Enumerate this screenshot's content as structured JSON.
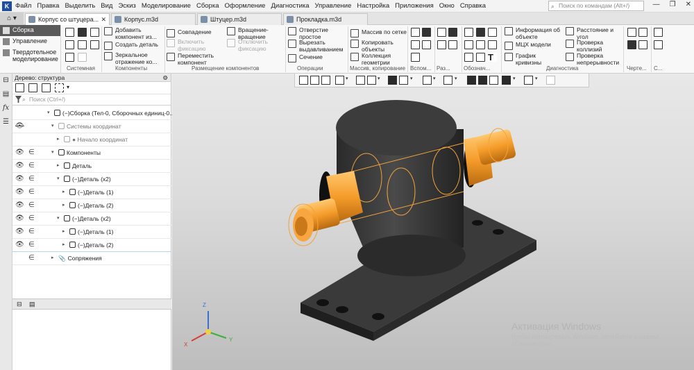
{
  "menu": [
    "Файл",
    "Правка",
    "Выделить",
    "Вид",
    "Эскиз",
    "Моделирование",
    "Сборка",
    "Оформление",
    "Диагностика",
    "Управление",
    "Настройка",
    "Приложения",
    "Окно",
    "Справка"
  ],
  "command_search": {
    "placeholder": "Поиск по командам (Alt+/)"
  },
  "tabs": [
    {
      "label": "Корпус со штуцера..."
    },
    {
      "label": "Корпус.m3d"
    },
    {
      "label": "Штуцер.m3d"
    },
    {
      "label": "Прокладка.m3d"
    }
  ],
  "modes": [
    "Сборка",
    "Управление",
    "Твердотельное моделирование"
  ],
  "ribbon": {
    "system_group": "Системная",
    "components": {
      "add": "Добавить компонент из...",
      "create": "Создать деталь",
      "mirror": "Зеркальное отражение ко...",
      "group": "Компоненты"
    },
    "placement": {
      "coincide": "Совпадение",
      "enable_fix": "Включить фиксацию",
      "move": "Переместить компонент",
      "rotate": "Вращение-вращение",
      "disable_fix": "Отключить фиксацию",
      "group": "Размещение компонентов"
    },
    "operations": {
      "hole": "Отверстие простое",
      "cut": "Вырезать выдавливанием",
      "section": "Сечение",
      "group": "Операции"
    },
    "array": {
      "grid": "Массив по сетке",
      "copy": "Копировать объекты",
      "collection": "Коллекция геометрии",
      "group": "Массив, копирование"
    },
    "aux_group": "Вспом...",
    "size_group": "Раз...",
    "desig_group": "Обознач...",
    "diag": {
      "info": "Информация об объекте",
      "mcx": "МЦХ модели",
      "curv": "График кривизны",
      "dist": "Расстояние и угол",
      "collision": "Проверка коллизий",
      "continuity": "Проверка непрерывности",
      "group": "Диагностика"
    },
    "drawing_group": "Черте...",
    "last_group": "С..."
  },
  "tree": {
    "title": "Дерево: структура",
    "search_placeholder": "Поиск (Ctrl+/)",
    "rows": [
      {
        "label": "(−)Сборка (Тел-0, Сборочных единиц-0...",
        "level": 0,
        "eye": false
      },
      {
        "label": "Системы координат",
        "level": 1,
        "eye": "off",
        "gray": true
      },
      {
        "label": "● Начало координат",
        "level": 2,
        "eye": false,
        "gray": true
      },
      {
        "label": "Компоненты",
        "level": 1,
        "eye": true
      },
      {
        "label": "Деталь",
        "level": 2,
        "eye": true
      },
      {
        "label": "(−)Деталь (x2)",
        "level": 2,
        "eye": true
      },
      {
        "label": "(−)Деталь (1)",
        "level": 3,
        "eye": true
      },
      {
        "label": "(−)Деталь (2)",
        "level": 3,
        "eye": true
      },
      {
        "label": "(−)Деталь (x2)",
        "level": 2,
        "eye": true
      },
      {
        "label": "(−)Деталь (1)",
        "level": 3,
        "eye": true
      },
      {
        "label": "(−)Деталь (2)",
        "level": 3,
        "eye": true
      },
      {
        "label": "Сопряжения",
        "level": 1,
        "eye": false
      }
    ]
  },
  "axes": {
    "x": "X",
    "y": "Y",
    "z": "Z"
  },
  "watermark": {
    "title": "Активация Windows",
    "hint": "Чтобы активировать Windows, перейдите в раздел «Параметры»."
  }
}
